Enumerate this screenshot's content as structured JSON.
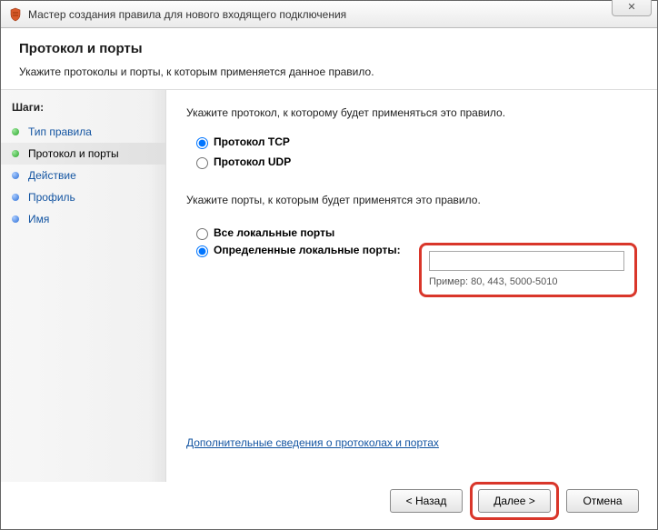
{
  "window": {
    "title": "Мастер создания правила для нового входящего подключения",
    "close_glyph": "✕"
  },
  "header": {
    "title": "Протокол и порты",
    "subtitle": "Укажите протоколы и порты, к которым применяется данное правило."
  },
  "sidebar": {
    "steps_label": "Шаги:",
    "items": [
      {
        "label": "Тип правила"
      },
      {
        "label": "Протокол и порты"
      },
      {
        "label": "Действие"
      },
      {
        "label": "Профиль"
      },
      {
        "label": "Имя"
      }
    ]
  },
  "content": {
    "protocol_prompt": "Укажите протокол, к которому будет применяться это правило.",
    "protocol_tcp": "Протокол TCP",
    "protocol_udp": "Протокол UDP",
    "ports_prompt": "Укажите порты, к которым будет применятся это правило.",
    "ports_all": "Все локальные порты",
    "ports_specific": "Определенные локальные порты:",
    "ports_value": "",
    "ports_example": "Пример: 80, 443, 5000-5010",
    "learn_more": "Дополнительные сведения о протоколах и портах"
  },
  "buttons": {
    "back": "< Назад",
    "next": "Далее >",
    "cancel": "Отмена"
  }
}
